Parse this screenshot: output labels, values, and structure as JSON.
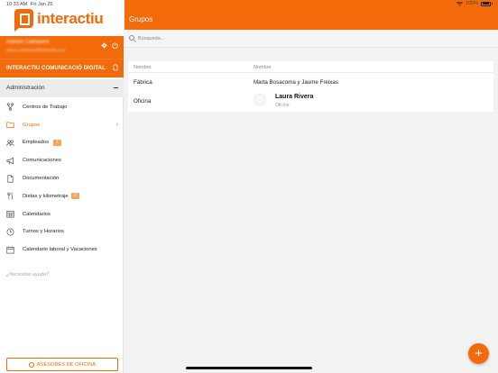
{
  "status_bar": {
    "time": "10:33 AM",
    "date": "Fri Jan 25",
    "battery_text": "100%"
  },
  "brand": {
    "logo_text": "interactiu",
    "accent_color": "#f26a0a"
  },
  "user": {
    "name": "Ramon Camarero",
    "email": "ramon.camarero@interactiu.com"
  },
  "company": {
    "name": "INTERACTIU COMUNICACIÓ DIGITAL"
  },
  "sidebar": {
    "section_title": "Administración",
    "items": [
      {
        "label": "Centros de Trabajo",
        "icon": "branch-icon",
        "active": false,
        "badge": null
      },
      {
        "label": "Grupos",
        "icon": "folder-icon",
        "active": true,
        "badge": null
      },
      {
        "label": "Empleados",
        "icon": "people-icon",
        "active": false,
        "badge": "1"
      },
      {
        "label": "Comunicaciones",
        "icon": "megaphone-icon",
        "active": false,
        "badge": null
      },
      {
        "label": "Documentación",
        "icon": "document-icon",
        "active": false,
        "badge": null
      },
      {
        "label": "Dietas y kilometraje",
        "icon": "cutlery-icon",
        "active": false,
        "badge": "2"
      },
      {
        "label": "Calendarios",
        "icon": "calendar-grid-icon",
        "active": false,
        "badge": null
      },
      {
        "label": "Turnos y Horarios",
        "icon": "clock-icon",
        "active": false,
        "badge": null
      },
      {
        "label": "Calendario laboral y Vacaciones",
        "icon": "calendar-icon",
        "active": false,
        "badge": null
      }
    ],
    "help_text": "¿Necesitas ayuda?",
    "advisors_button": "ASESORES DE OFICINA"
  },
  "main": {
    "title": "Grupos",
    "search_placeholder": "Búsqueda...",
    "table": {
      "headers": [
        "Nombre",
        "Nombre"
      ],
      "rows": [
        {
          "group": "Fábrica",
          "names": "Marta Bosacoma y Jaume Freixas"
        },
        {
          "group": "Oficina",
          "person_name": "Laura Rivera",
          "person_role": "Oficina"
        }
      ]
    },
    "fab_label": "+"
  }
}
